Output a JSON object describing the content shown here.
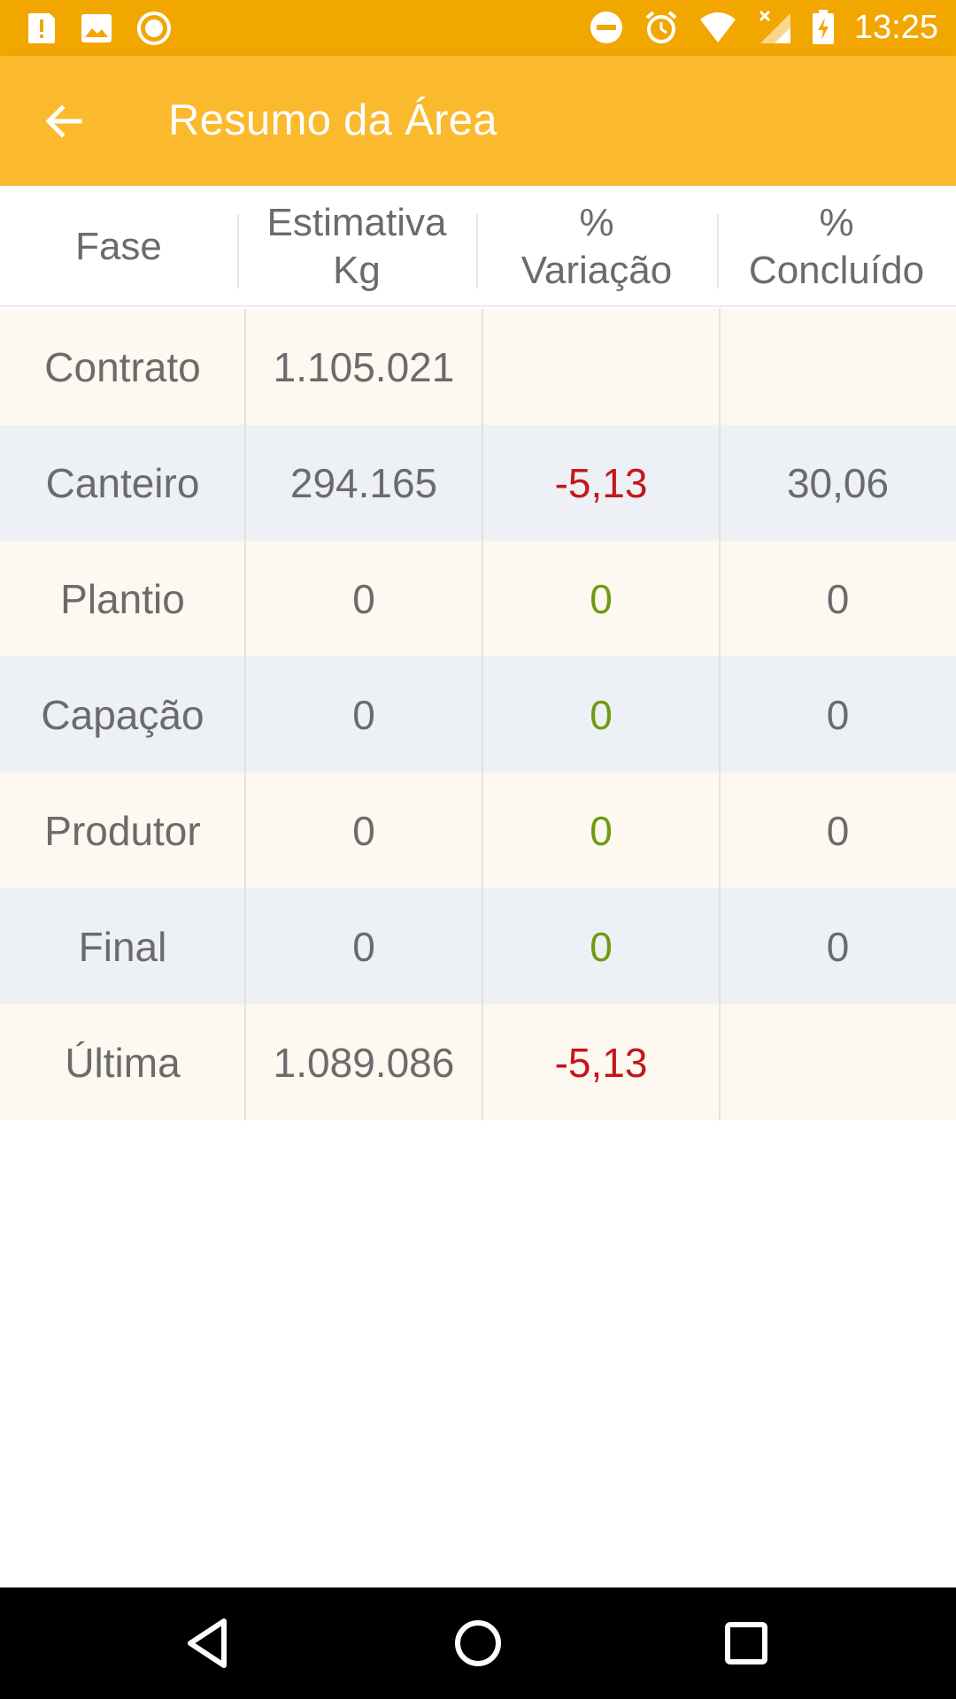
{
  "status_bar": {
    "time": "13:25",
    "left_icons": [
      "alert-icon",
      "image-icon",
      "record-icon"
    ],
    "right_icons": [
      "do-not-disturb-icon",
      "alarm-icon",
      "wifi-icon",
      "signal-icon",
      "battery-charging-icon"
    ]
  },
  "app_bar": {
    "title": "Resumo da Área",
    "back_icon": "arrow-back-icon"
  },
  "table": {
    "headers": [
      {
        "line1": "Fase",
        "line2": ""
      },
      {
        "line1": "Estimativa",
        "line2": "Kg"
      },
      {
        "line1": "%",
        "line2": "Variação"
      },
      {
        "line1": "%",
        "line2": "Concluído"
      }
    ],
    "rows": [
      {
        "fase": "Contrato",
        "estimativa": "1.105.021",
        "variacao": "",
        "concluido": ""
      },
      {
        "fase": "Canteiro",
        "estimativa": "294.165",
        "variacao": "-5,13",
        "concluido": "30,06"
      },
      {
        "fase": "Plantio",
        "estimativa": "0",
        "variacao": "0",
        "concluido": "0"
      },
      {
        "fase": "Capação",
        "estimativa": "0",
        "variacao": "0",
        "concluido": "0"
      },
      {
        "fase": "Produtor",
        "estimativa": "0",
        "variacao": "0",
        "concluido": "0"
      },
      {
        "fase": "Final",
        "estimativa": "0",
        "variacao": "0",
        "concluido": "0"
      },
      {
        "fase": "Última",
        "estimativa": "1.089.086",
        "variacao": "-5,13",
        "concluido": ""
      }
    ],
    "colors": {
      "negative": "#c4161c",
      "zero": "#6f9a0f",
      "row_odd": "#fdf8f0",
      "row_even": "#edf0f4"
    }
  },
  "nav_bar": {
    "buttons": [
      "back-triangle-icon",
      "home-circle-icon",
      "recents-square-icon"
    ]
  },
  "colors": {
    "status_bar": "#f2a600",
    "app_bar": "#fbb92d"
  }
}
